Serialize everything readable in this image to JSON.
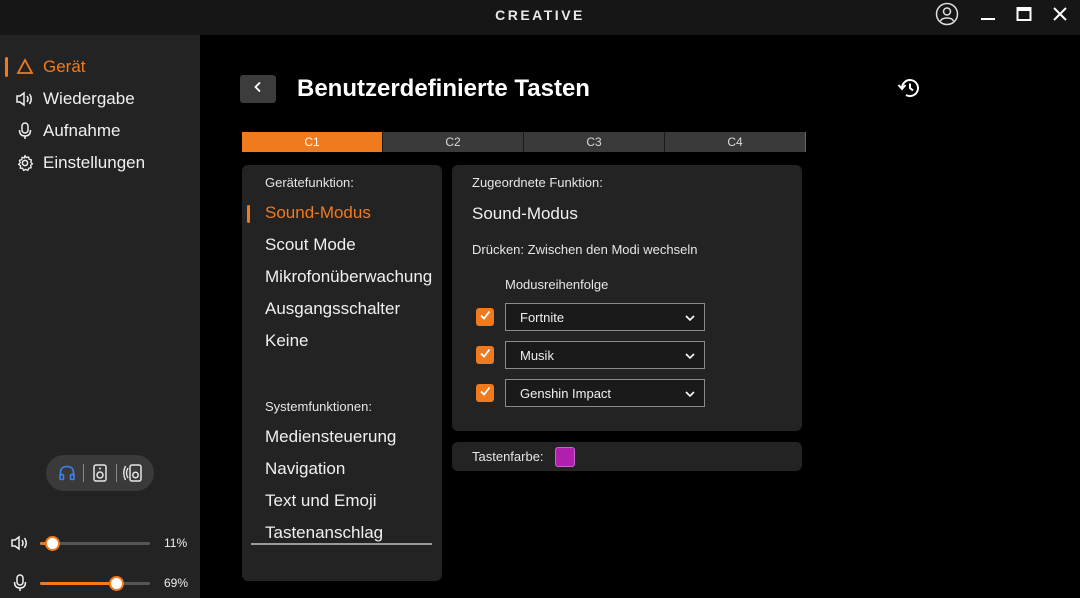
{
  "app": {
    "logo_text": "CREATIVE"
  },
  "window_controls": [
    "account-icon",
    "minimize-icon",
    "maximize-icon",
    "close-icon"
  ],
  "sidebar": {
    "items": [
      {
        "label": "Gerät",
        "icon": "device-icon",
        "active": true
      },
      {
        "label": "Wiedergabe",
        "icon": "speaker-icon",
        "active": false
      },
      {
        "label": "Aufnahme",
        "icon": "microphone-icon",
        "active": false
      },
      {
        "label": "Einstellungen",
        "icon": "gear-icon",
        "active": false
      }
    ],
    "output_selector": [
      "headphones-icon",
      "speaker-box-icon",
      "surround-speaker-icon"
    ],
    "volume": {
      "icon": "speaker-icon",
      "value_percent": 11,
      "label": "11%"
    },
    "mic": {
      "icon": "microphone-icon",
      "value_percent": 69,
      "label": "69%"
    }
  },
  "header": {
    "title": "Benutzerdefinierte Tasten",
    "back_icon": "chevron-left-icon",
    "reset_icon": "reset-icon"
  },
  "tabs": [
    {
      "label": "C1",
      "active": true
    },
    {
      "label": "C2",
      "active": false
    },
    {
      "label": "C3",
      "active": false
    },
    {
      "label": "C4",
      "active": false
    }
  ],
  "device_functions": {
    "label": "Gerätefunktion:",
    "items": [
      "Sound-Modus",
      "Scout Mode",
      "Mikrofonüberwachung",
      "Ausgangsschalter",
      "Keine"
    ],
    "active_index": 0
  },
  "system_functions": {
    "label": "Systemfunktionen:",
    "items": [
      "Mediensteuerung",
      "Navigation",
      "Text und Emoji",
      "Tastenanschlag"
    ]
  },
  "assigned": {
    "label": "Zugeordnete Funktion:",
    "function": "Sound-Modus",
    "description": "Drücken: Zwischen den Modi wechseln",
    "order_label": "Modusreihenfolge",
    "modes": [
      {
        "value": "Fortnite",
        "checked": true
      },
      {
        "value": "Musik",
        "checked": true
      },
      {
        "value": "Genshin Impact",
        "checked": true
      }
    ]
  },
  "key_color": {
    "label": "Tastenfarbe:",
    "color": "#b01fae"
  },
  "colors": {
    "accent": "#f07a1e",
    "sidebar_bg": "#232323",
    "panel_bg": "#232323"
  }
}
